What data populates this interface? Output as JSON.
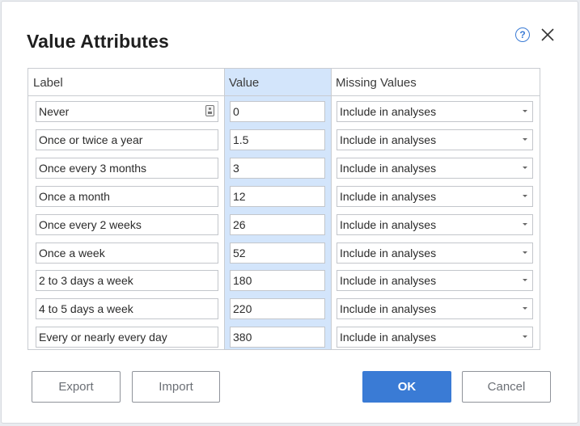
{
  "dialog": {
    "title": "Value Attributes",
    "help_icon": "help-circle-icon",
    "help_glyph": "?",
    "close_icon": "close-x-icon"
  },
  "columns": {
    "label": "Label",
    "value": "Value",
    "missing": "Missing Values"
  },
  "rows": [
    {
      "label": "Never",
      "value": "0",
      "missing": "Include in analyses"
    },
    {
      "label": "Once or twice a year",
      "value": "1.5",
      "missing": "Include in analyses"
    },
    {
      "label": "Once every 3 months",
      "value": "3",
      "missing": "Include in analyses"
    },
    {
      "label": "Once a month",
      "value": "12",
      "missing": "Include in analyses"
    },
    {
      "label": "Once every 2 weeks",
      "value": "26",
      "missing": "Include in analyses"
    },
    {
      "label": "Once a week",
      "value": "52",
      "missing": "Include in analyses"
    },
    {
      "label": "2 to 3 days a week",
      "value": "180",
      "missing": "Include in analyses"
    },
    {
      "label": "4 to 5 days a week",
      "value": "220",
      "missing": "Include in analyses"
    },
    {
      "label": "Every or nearly every day",
      "value": "380",
      "missing": "Include in analyses"
    }
  ],
  "buttons": {
    "export": "Export",
    "import": "Import",
    "ok": "OK",
    "cancel": "Cancel"
  },
  "colors": {
    "accent": "#3a7bd5",
    "value_column_highlight": "#d3e5fb"
  }
}
